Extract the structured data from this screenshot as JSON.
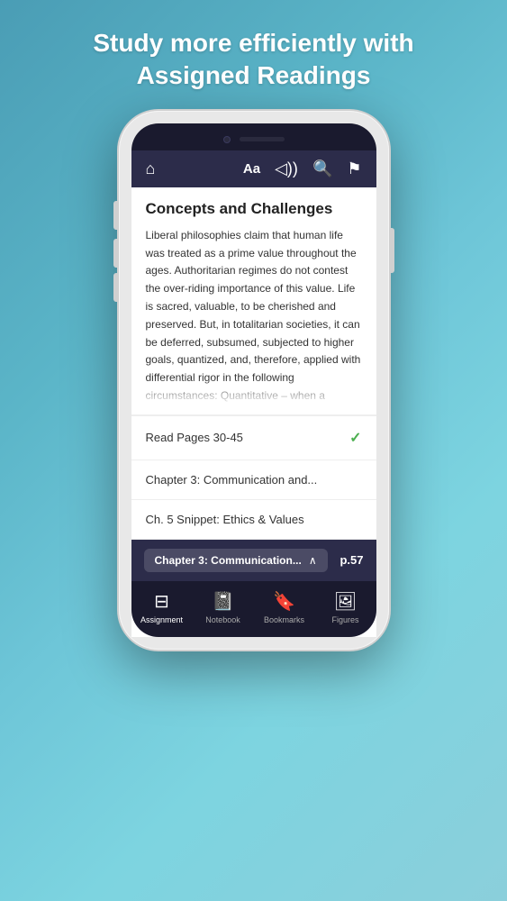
{
  "hero": {
    "line1": "Study more efficiently with",
    "line2": "Assigned Readings"
  },
  "topbar": {
    "home_icon": "⌂",
    "font_label": "Aa",
    "volume_icon": "🔊",
    "search_icon": "🔍",
    "bookmark_icon": "🔖"
  },
  "reading": {
    "title": "Concepts and Challenges",
    "body": "Liberal philosophies claim that human life was treated as a prime value throughout the ages. Authoritarian regimes do not contest the over-riding importance of this value. Life is sacred, valuable, to be cherished and preserved. But, in totalitarian societies, it can be deferred, subsumed, subjected to higher goals, quantized, and, therefore, applied with differential rigor in the following circumstances: Quantitative – when a"
  },
  "assignments": [
    {
      "text": "Read Pages 30-45",
      "done": true
    },
    {
      "text": "Chapter 3: Communication and...",
      "done": false
    },
    {
      "text": "Ch. 5 Snippet: Ethics & Values",
      "done": false
    }
  ],
  "chapter_bar": {
    "title": "Chapter 3: Communication...",
    "page": "p.57"
  },
  "nav": [
    {
      "icon": "📋",
      "label": "Assignment",
      "active": true
    },
    {
      "icon": "📓",
      "label": "Notebook",
      "active": false
    },
    {
      "icon": "🔖",
      "label": "Bookmarks",
      "active": false
    },
    {
      "icon": "🖼",
      "label": "Figures",
      "active": false
    }
  ]
}
